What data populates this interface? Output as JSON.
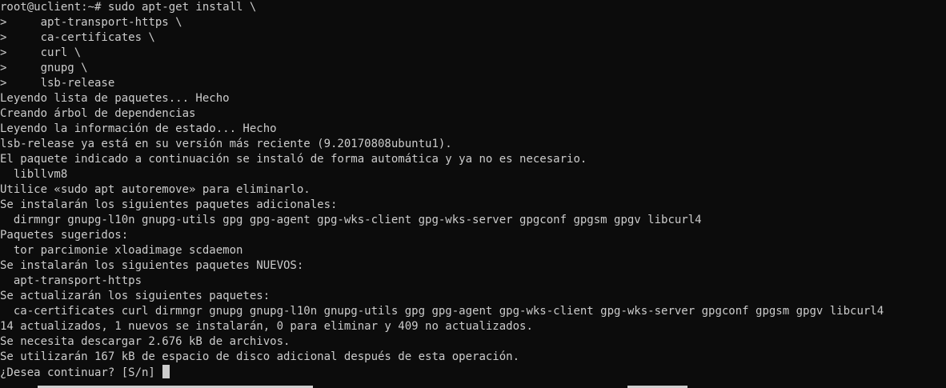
{
  "terminal": {
    "lines": [
      "root@uclient:~# sudo apt-get install \\",
      ">     apt-transport-https \\",
      ">     ca-certificates \\",
      ">     curl \\",
      ">     gnupg \\",
      ">     lsb-release",
      "Leyendo lista de paquetes... Hecho",
      "Creando árbol de dependencias",
      "Leyendo la información de estado... Hecho",
      "lsb-release ya está en su versión más reciente (9.20170808ubuntu1).",
      "El paquete indicado a continuación se instaló de forma automática y ya no es necesario.",
      "  libllvm8",
      "Utilice «sudo apt autoremove» para eliminarlo.",
      "Se instalarán los siguientes paquetes adicionales:",
      "  dirmngr gnupg-l10n gnupg-utils gpg gpg-agent gpg-wks-client gpg-wks-server gpgconf gpgsm gpgv libcurl4",
      "Paquetes sugeridos:",
      "  tor parcimonie xloadimage scdaemon",
      "Se instalarán los siguientes paquetes NUEVOS:",
      "  apt-transport-https",
      "Se actualizarán los siguientes paquetes:",
      "  ca-certificates curl dirmngr gnupg gnupg-l10n gnupg-utils gpg gpg-agent gpg-wks-client gpg-wks-server gpgconf gpgsm gpgv libcurl4",
      "14 actualizados, 1 nuevos se instalarán, 0 para eliminar y 409 no actualizados.",
      "Se necesita descargar 2.676 kB de archivos.",
      "Se utilizarán 167 kB de espacio de disco adicional después de esta operación."
    ],
    "prompt_line": "¿Desea continuar? [S/n] "
  },
  "colors": {
    "background": "#0c0c0c",
    "text": "#cccccc",
    "cursor": "#cccccc"
  }
}
